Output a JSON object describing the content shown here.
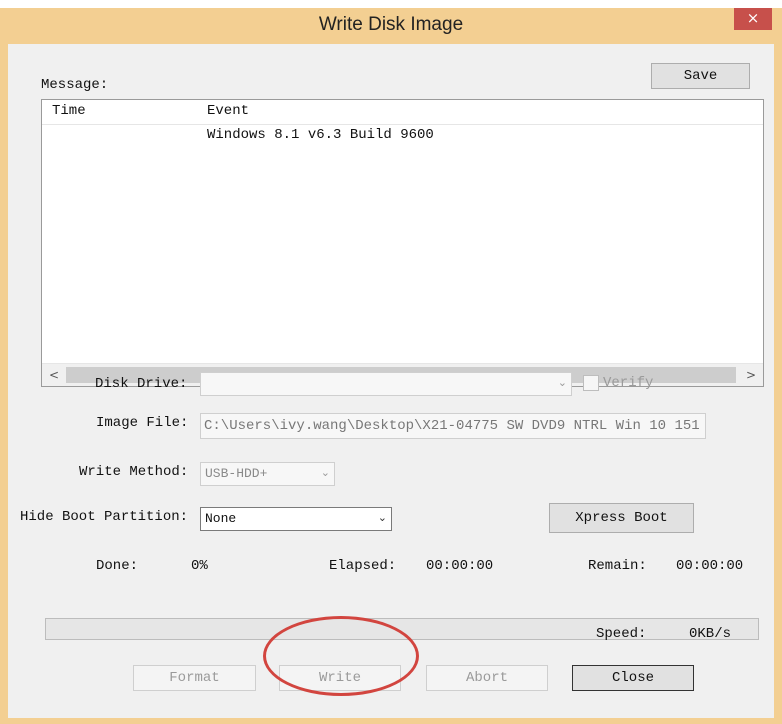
{
  "window": {
    "title": "Write Disk Image",
    "close_glyph": "×"
  },
  "message": {
    "label": "Message:",
    "save_label": "Save",
    "columns": [
      "Time",
      "Event"
    ],
    "rows": [
      {
        "time": "",
        "event": "Windows 8.1 v6.3 Build 9600"
      }
    ],
    "scroll_left": "<",
    "scroll_right": ">"
  },
  "form": {
    "disk_drive_label": "Disk Drive:",
    "disk_drive_value": "",
    "verify_label": "Verify",
    "verify_checked": false,
    "image_file_label": "Image File:",
    "image_file_value": "C:\\Users\\ivy.wang\\Desktop\\X21-04775 SW DVD9 NTRL Win 10 151",
    "write_method_label": "Write Method:",
    "write_method_value": "USB-HDD+",
    "hide_boot_label": "Hide Boot Partition:",
    "hide_boot_value": "None",
    "xpress_boot_label": "Xpress Boot"
  },
  "progress": {
    "done_label": "Done:",
    "done_value": "0%",
    "elapsed_label": "Elapsed:",
    "elapsed_value": "00:00:00",
    "remain_label": "Remain:",
    "remain_value": "00:00:00",
    "speed_label": "Speed:",
    "speed_value": "0KB/s",
    "fraction": 0
  },
  "buttons": {
    "format": "Format",
    "write": "Write",
    "abort": "Abort",
    "close": "Close"
  },
  "colors": {
    "frame": "#f3cf92",
    "close_button": "#c7504b",
    "annotation_circle": "#d2453f"
  },
  "icons": {
    "dropdown": "chevron-down-icon",
    "close": "close-icon"
  }
}
